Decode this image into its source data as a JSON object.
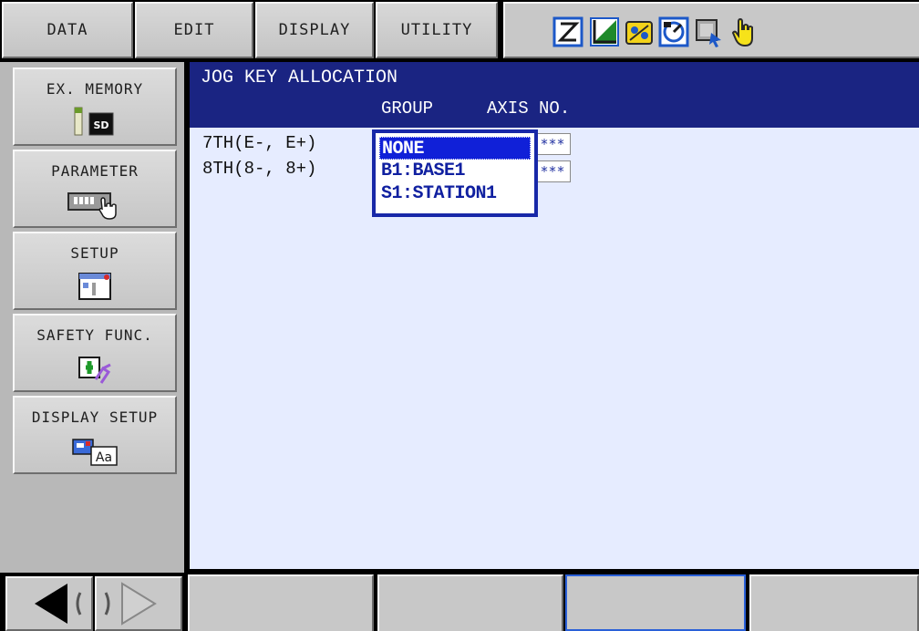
{
  "menu": {
    "data_label": "DATA",
    "edit_label": "EDIT",
    "display_label": "DISPLAY",
    "utility_label": "UTILITY"
  },
  "status_icons": [
    "frame-icon",
    "coordinate-icon",
    "job-icon",
    "speed-icon",
    "cursor-icon",
    "hand-icon"
  ],
  "main_menu": [
    {
      "label": "EX. MEMORY",
      "icon": "sd-card-icon"
    },
    {
      "label": "PARAMETER",
      "icon": "parameter-icon"
    },
    {
      "label": "SETUP",
      "icon": "setup-icon"
    },
    {
      "label": "SAFETY FUNC.",
      "icon": "safety-icon"
    },
    {
      "label": "DISPLAY SETUP",
      "icon": "display-setup-icon"
    }
  ],
  "window": {
    "title": "JOG KEY ALLOCATION",
    "col_group": "GROUP",
    "col_axis": "AXIS NO.",
    "rows": [
      {
        "label": "7TH(E-, E+)",
        "axis": "***"
      },
      {
        "label": "8TH(8-, 8+)",
        "axis": "***"
      }
    ]
  },
  "dropdown": {
    "options": [
      "NONE",
      "B1:BASE1",
      "S1:STATION1"
    ],
    "selected": "NONE"
  },
  "colors": {
    "title_bar": "#1a2482",
    "window_bg": "#e6ecff",
    "selection": "#1020d8"
  }
}
